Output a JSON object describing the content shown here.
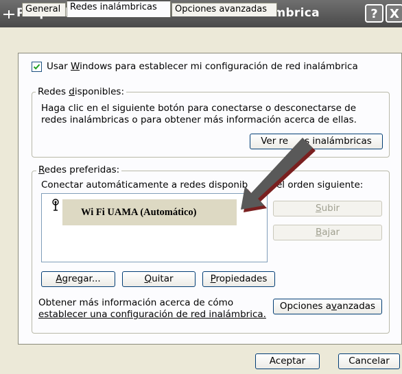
{
  "window": {
    "title": "Propiedades de Conexión de red inalámbrica",
    "help_button": "?",
    "close_button": "X"
  },
  "tabs": [
    {
      "label": "General",
      "active": false
    },
    {
      "label": "Redes inalámbricas",
      "active": true
    },
    {
      "label": "Opciones avanzadas",
      "active": false
    }
  ],
  "use_windows_checkbox": {
    "checked": true,
    "label_pre": "Usar ",
    "label_accel": "W",
    "label_post": "indows para establecer mi configuración de red inalámbrica"
  },
  "available_networks": {
    "title_pre": "Redes ",
    "title_accel": "d",
    "title_post": "isponibles:",
    "line1": "Haga clic en el siguiente botón para conectarse o desconectarse de",
    "line2": "redes inalámbricas o para obtener más información acerca de ellas.",
    "view_button_pre": "Ver re",
    "view_button_post": "s inalámbricas"
  },
  "preferred_networks": {
    "title_accel": "R",
    "title_post": "edes preferidas:",
    "description_pre": "Conectar automáticamente a redes disponib",
    "description_post": "el orden siguiente:",
    "items": [
      {
        "label": "Wi Fi UAMA   (Automático)"
      }
    ],
    "up_button_accel": "S",
    "up_button_post": "ubir",
    "down_button_accel": "B",
    "down_button_post": "ajar",
    "add_button_accel": "A",
    "add_button_post": "gregar...",
    "remove_button_accel": "Q",
    "remove_button_post": "uitar",
    "properties_button_accel": "P",
    "properties_button_post": "ropiedades"
  },
  "info": {
    "line1": "Obtener más información acerca de cómo",
    "link": "establecer una configuración de red inalámbrica.",
    "advanced_button_pre": "Opciones a",
    "advanced_button_accel": "v",
    "advanced_button_post": "anzadas"
  },
  "footer": {
    "ok_button": "Aceptar",
    "cancel_button": "Cancelar"
  },
  "colors": {
    "titlebar": "#5a5a5a",
    "dialog_bg": "#ece9d8",
    "panel_bg": "#fcfcfe",
    "selected_item": "#ddd9c3",
    "arrow": "#595959",
    "arrow_shadow": "#7a2020"
  }
}
